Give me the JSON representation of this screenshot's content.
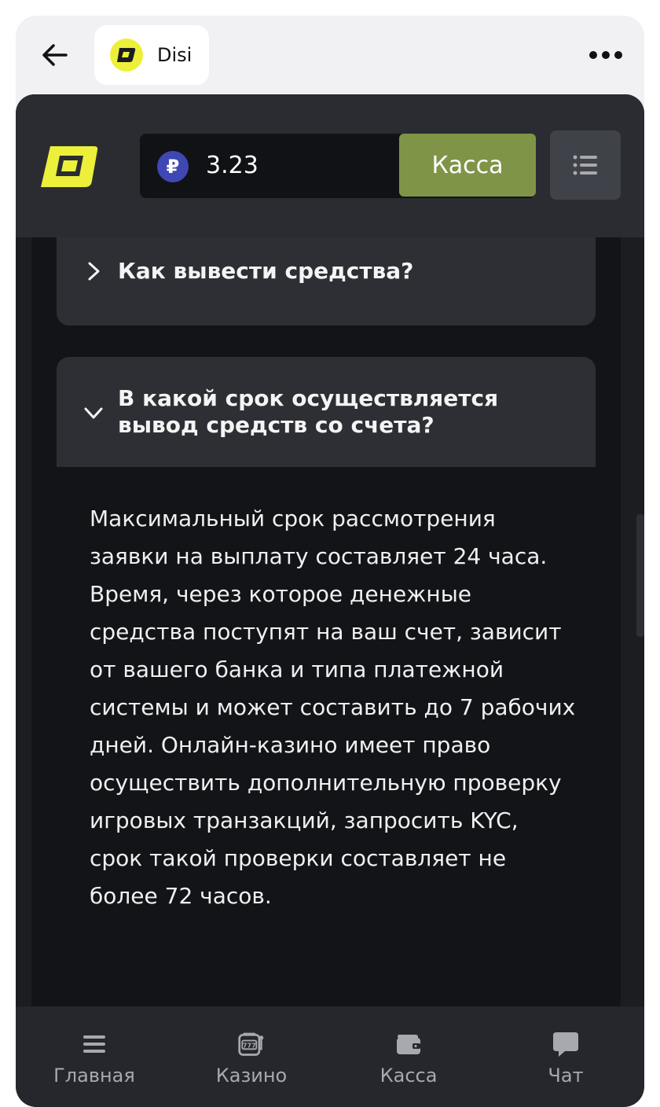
{
  "topbar": {
    "app_name": "Disi"
  },
  "header": {
    "balance": "3.23",
    "currency_symbol": "₽",
    "cashier_label": "Касса"
  },
  "faq": [
    {
      "question": "Как вывести средства?",
      "expanded": false
    },
    {
      "question": "В какой срок осуществляется вывод средств со счета?",
      "expanded": true,
      "answer": "Максимальный срок рассмотрения заявки на выплату составляет 24 часа. Время, через которое денежные средства поступят на ваш счет, зависит от вашего банка и типа платежной системы и может составить до 7 рабочих дней. Онлайн-казино имеет право осуществить дополнительную проверку игровых транзакций, запросить KYC, срок такой проверки составляет не более 72 часов."
    }
  ],
  "bottom_nav": [
    {
      "label": "Главная",
      "icon": "menu-icon"
    },
    {
      "label": "Казино",
      "icon": "slot-machine-icon"
    },
    {
      "label": "Касса",
      "icon": "wallet-icon"
    },
    {
      "label": "Чат",
      "icon": "chat-icon"
    }
  ],
  "colors": {
    "accent": "#7f9447",
    "brand_yellow": "#ecf03a",
    "background": "#1c1d21"
  }
}
